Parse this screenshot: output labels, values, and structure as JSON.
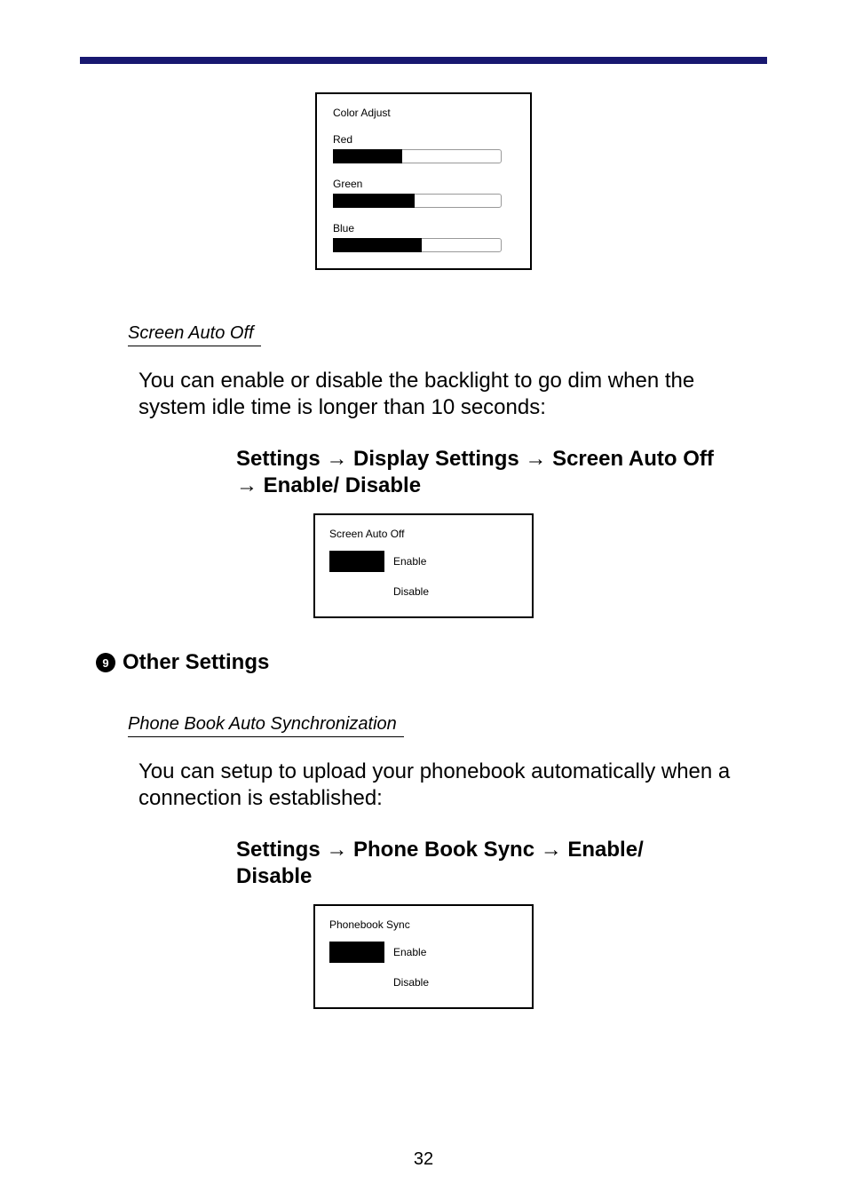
{
  "color_panel": {
    "title": "Color Adjust",
    "sliders": [
      {
        "label": "Red"
      },
      {
        "label": "Green"
      },
      {
        "label": "Blue"
      }
    ]
  },
  "section_screen": {
    "heading": "Screen Auto Off",
    "body": "You can enable or disable the backlight to go dim when the system idle time is longer than 10 seconds:",
    "path": "Settings → Display Settings → Screen Auto Off → Enable/ Disable",
    "panel": {
      "title": "Screen Auto Off",
      "opts": [
        "Enable",
        "Disable"
      ]
    }
  },
  "section_other": {
    "num": "9",
    "title": "Other Settings"
  },
  "section_pbsync": {
    "heading": "Phone Book Auto Synchronization",
    "body": "You can setup to upload your phonebook automatically when a connection is established:",
    "path": "Settings → Phone Book Sync → Enable/ Disable",
    "panel": {
      "title": "Phonebook Sync",
      "opts": [
        "Enable",
        "Disable"
      ]
    }
  },
  "page_number": "32"
}
